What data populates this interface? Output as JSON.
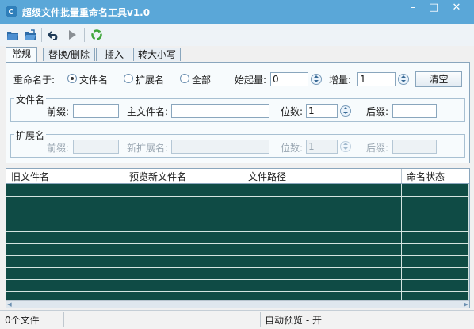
{
  "titlebar": {
    "title": "超级文件批量重命名工具v1.0",
    "min": "–",
    "max": "□",
    "close": "✕"
  },
  "toolbar": {
    "icons": [
      "open-file-icon",
      "open-folder-icon",
      "undo-icon",
      "run-icon",
      "recycle-icon"
    ],
    "colors": {
      "accent": "#5aa7d8",
      "recycle": "#3fa63a"
    }
  },
  "tabs": [
    "常规",
    "替换/删除",
    "插入",
    "转大小写"
  ],
  "general": {
    "rename_label": "重命名于:",
    "rename_options": [
      "文件名",
      "扩展名",
      "全部"
    ],
    "selected_option": "文件名",
    "start_label": "始起量:",
    "start_value": "0",
    "increment_label": "增量:",
    "increment_value": "1",
    "clear_label": "清空"
  },
  "filename_group": {
    "title": "文件名",
    "prefix_label": "前缀:",
    "prefix_value": "",
    "main_label": "主文件名:",
    "main_value": "",
    "digits_label": "位数:",
    "digits_value": "1",
    "suffix_label": "后缀:",
    "suffix_value": ""
  },
  "ext_group": {
    "title": "扩展名",
    "prefix_label": "前缀:",
    "new_ext_label": "新扩展名:",
    "digits_label": "位数:",
    "digits_value": "1",
    "suffix_label": "后缀:"
  },
  "table": {
    "columns": [
      "旧文件名",
      "预览新文件名",
      "文件路径",
      "命名状态"
    ],
    "row_count": 10,
    "colors": {
      "body": "#0f4b45"
    }
  },
  "status": {
    "files": "0个文件",
    "auto_preview": "自动预览 - 开"
  }
}
